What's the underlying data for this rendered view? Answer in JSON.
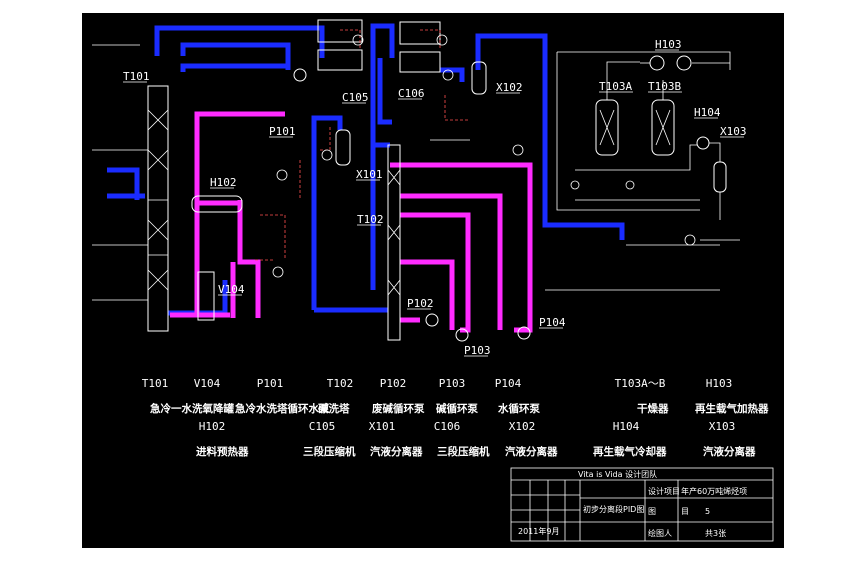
{
  "equipment_tags": {
    "t101": "T101",
    "h102": "H102",
    "v104": "V104",
    "p101": "P101",
    "c105": "C105",
    "c106": "C106",
    "x101": "X101",
    "x102": "X102",
    "t102": "T102",
    "p102": "P102",
    "p103": "P103",
    "p104": "P104",
    "h103": "H103",
    "t103a": "T103A",
    "t103b": "T103B",
    "h104": "H104",
    "x103": "X103"
  },
  "legend": [
    {
      "tag": "T101",
      "name": "急冷一水洗氧降罐"
    },
    {
      "tag": "V104",
      "name": ""
    },
    {
      "tag": "P101",
      "name": "急冷水洗塔循环水泵"
    },
    {
      "tag": "T102",
      "name": "碱洗塔"
    },
    {
      "tag": "P102",
      "name": "废碱循环泵"
    },
    {
      "tag": "P103",
      "name": "碱循环泵"
    },
    {
      "tag": "P104",
      "name": "水循环泵"
    },
    {
      "tag": "T103A～B",
      "name": "干燥器"
    },
    {
      "tag": "H103",
      "name": "再生载气加热器"
    },
    {
      "tag": "H102",
      "name": "进料预热器"
    },
    {
      "tag": "C105",
      "name": "三段压缩机"
    },
    {
      "tag": "X101",
      "name": "汽液分离器"
    },
    {
      "tag": "C106",
      "name": "三段压缩机"
    },
    {
      "tag": "X102",
      "name": "汽液分离器"
    },
    {
      "tag": "H104",
      "name": "再生载气冷却器"
    },
    {
      "tag": "X103",
      "name": "汽液分离器"
    }
  ],
  "title_block": {
    "header": "Vita is Vida 设计团队",
    "drawing_name": "初步分离段PID图",
    "design_label": "设计项目",
    "project": "年产60万吨烯烃项",
    "row2_left": "图",
    "row2_mid": "目",
    "sheet_no": "5",
    "date": "2011年9月",
    "drawer": "绘图人",
    "total": "共3张"
  }
}
